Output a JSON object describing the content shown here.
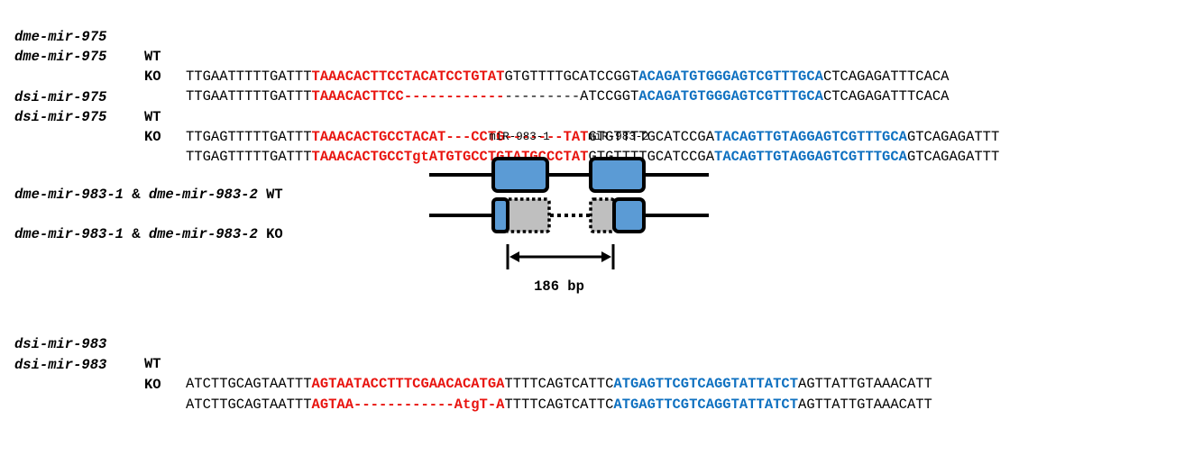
{
  "alignments": [
    {
      "id": "dme-975-wt",
      "gene": "dme-mir-975",
      "genotype": "WT",
      "segments": [
        {
          "t": "TTGAATTTTTGATTT",
          "c": "plain"
        },
        {
          "t": "TAAACACTTCCTACATCCTGTAT",
          "c": "red"
        },
        {
          "t": "GTGTTTTGCATCCGGT",
          "c": "plain"
        },
        {
          "t": "ACAGATGTGGGAGTCGTTTGCA",
          "c": "blue"
        },
        {
          "t": "CTCAGAGATTTCACA",
          "c": "plain"
        }
      ]
    },
    {
      "id": "dme-975-ko",
      "gene": "dme-mir-975",
      "genotype": "KO",
      "segments": [
        {
          "t": "TTGAATTTTTGATTT",
          "c": "plain"
        },
        {
          "t": "TAAACACTTCC------------",
          "c": "red"
        },
        {
          "t": "---------ATCCGGT",
          "c": "plain"
        },
        {
          "t": "ACAGATGTGGGAGTCGTTTGCA",
          "c": "blue"
        },
        {
          "t": "CTCAGAGATTTCACA",
          "c": "plain"
        }
      ]
    },
    {
      "id": "dsi-975-wt",
      "gene": "dsi-mir-975",
      "genotype": "WT",
      "segments": [
        {
          "t": "TTGAGTTTTTGATTT",
          "c": "plain"
        },
        {
          "t": "TAAACACTGCCTACAT---CCTG-------TAT",
          "c": "red"
        },
        {
          "t": "GTGTTTTGCATCCGA",
          "c": "plain"
        },
        {
          "t": "TACAGTTGTAGGAGTCGTTTGCA",
          "c": "blue"
        },
        {
          "t": "GTCAGAGATTT",
          "c": "plain"
        }
      ]
    },
    {
      "id": "dsi-975-ko",
      "gene": "dsi-mir-975",
      "genotype": "KO",
      "segments": [
        {
          "t": "TTGAGTTTTTGATTT",
          "c": "plain"
        },
        {
          "t": "TAAACACTGCCTgtATGTGCCTGTATGCCCTAT",
          "c": "red"
        },
        {
          "t": "GTGTTTTGCATCCGA",
          "c": "plain"
        },
        {
          "t": "TACAGTTGTAGGAGTCGTTTGCA",
          "c": "blue"
        },
        {
          "t": "GTCAGAGATTT",
          "c": "plain"
        }
      ]
    },
    {
      "id": "dsi-983-wt",
      "gene": "dsi-mir-983",
      "genotype": "WT",
      "segments": [
        {
          "t": "ATCTTGCAGTAATTT",
          "c": "plain"
        },
        {
          "t": "AGTAATACCTTTCGAACACATGA",
          "c": "red"
        },
        {
          "t": "TTTTCAGTCATTC",
          "c": "plain"
        },
        {
          "t": "ATGAGTTCGTCAGGTATTATCT",
          "c": "blue"
        },
        {
          "t": "AGTTATTGTAAACATT",
          "c": "plain"
        }
      ]
    },
    {
      "id": "dsi-983-ko",
      "gene": "dsi-mir-983",
      "genotype": "KO",
      "segments": [
        {
          "t": "ATCTTGCAGTAATTT",
          "c": "plain"
        },
        {
          "t": "AGTAA------------AtgT-A",
          "c": "red"
        },
        {
          "t": "TTTTCAGTCATTC",
          "c": "plain"
        },
        {
          "t": "ATGAGTTCGTCAGGTATTATCT",
          "c": "blue"
        },
        {
          "t": "AGTTATTGTAAACATT",
          "c": "plain"
        }
      ]
    }
  ],
  "mir983_diagram": {
    "wt_label": {
      "gene1": "dme-mir-983-1",
      "joiner": " & ",
      "gene2": "dme-mir-983-2",
      "genotype": "WT"
    },
    "ko_label": {
      "gene1": "dme-mir-983-1",
      "joiner": " & ",
      "gene2": "dme-mir-983-2",
      "genotype": "KO"
    },
    "hairpin1_label": "miR-983-1",
    "hairpin2_label": "miR-983-2",
    "deletion_size": "186 bp"
  },
  "colors": {
    "mature_5p": "#e8140f",
    "mature_3p": "#0e70c0",
    "hairpin_fill": "#5b9bd5",
    "deleted_fill": "#bfbfbf"
  }
}
